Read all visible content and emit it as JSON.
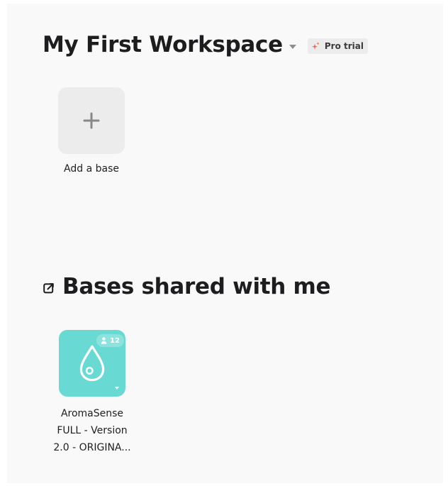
{
  "workspace": {
    "title": "My First Workspace",
    "badge": "Pro trial",
    "add_base_label": "Add a base"
  },
  "shared": {
    "title": "Bases shared with me",
    "bases": [
      {
        "name_lines": [
          "AromaSense",
          "FULL - Version",
          "2.0 - ORIGINA..."
        ],
        "collaborator_count": "12",
        "icon": "droplet-icon",
        "color": "#69dad3"
      }
    ]
  },
  "icons": {
    "workspace_menu": "chevron-down-icon",
    "pro_badge": "sparkle-icon",
    "add_base": "plus-icon",
    "shared_section": "external-share-icon",
    "collaborators": "person-icon",
    "base_menu": "chevron-down-icon"
  },
  "colors": {
    "background": "#f9f9f9",
    "tile_background": "#ececec",
    "base_tile": "#69dad3",
    "sparkle_accent": "#f36b3b"
  }
}
